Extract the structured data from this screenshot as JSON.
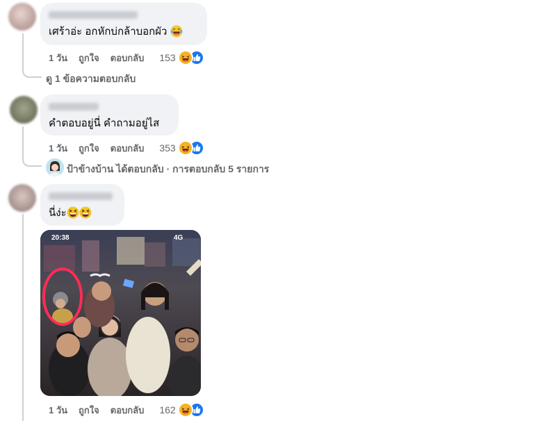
{
  "comments": [
    {
      "text": "เศร้าอ่ะ อกหักบ่กล้าบอกผัว",
      "emoji": "laugh-cry-emoji",
      "time": "1 วัน",
      "like_label": "ถูกใจ",
      "reply_label": "ตอบกลับ",
      "reaction_count": "153",
      "reactions": [
        "haha",
        "like"
      ],
      "view_replies": "ดู 1 ข้อความตอบกลับ"
    },
    {
      "text": "คำตอบอยู่นี่ คำถามอยู่ไส",
      "time": "1 วัน",
      "like_label": "ถูกใจ",
      "reply_label": "ตอบกลับ",
      "reaction_count": "353",
      "reactions": [
        "haha",
        "like"
      ],
      "reply_summary": "ป้าข้างบ้าน ได้ตอบกลับ · การตอบกลับ 5 รายการ"
    },
    {
      "text": "นี่ง่ะ",
      "emoji": "grinning-squint-emoji",
      "time": "1 วัน",
      "like_label": "ถูกใจ",
      "reply_label": "ตอบกลับ",
      "reaction_count": "162",
      "reactions": [
        "haha",
        "like"
      ],
      "photo": {
        "status_time": "20:38",
        "status_network": "4G"
      }
    }
  ],
  "colors": {
    "bubble": "#f0f2f5",
    "meta_text": "#65676b",
    "haha": "#f7b125",
    "like": "#1877f2",
    "circle_annotation": "#ff2d55"
  }
}
